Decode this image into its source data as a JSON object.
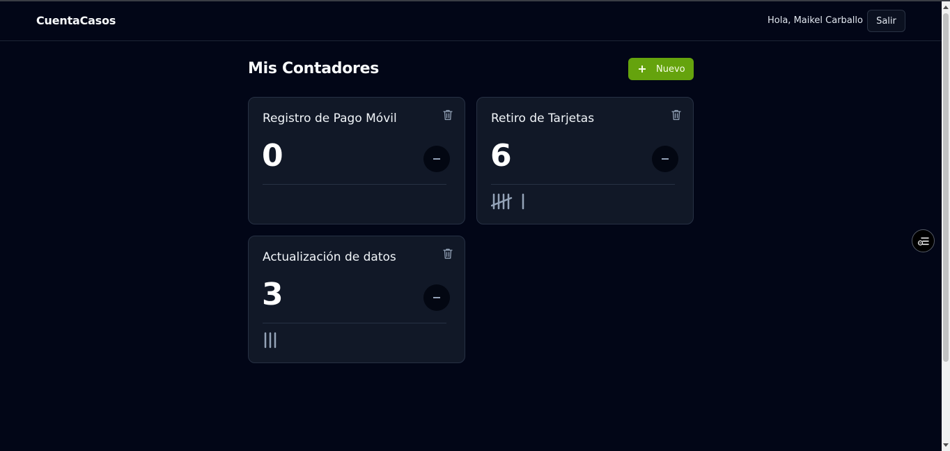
{
  "header": {
    "brand": "CuentaCasos",
    "greeting": "Hola, Maikel Carballo",
    "logout_label": "Salir"
  },
  "main": {
    "title": "Mis Contadores",
    "new_button_label": "Nuevo"
  },
  "counters": [
    {
      "name": "Registro de Pago Móvil",
      "count": "0",
      "tally_value": 0
    },
    {
      "name": "Retiro de Tarjetas",
      "count": "6",
      "tally_value": 6
    },
    {
      "name": "Actualización de datos",
      "count": "3",
      "tally_value": 3
    }
  ],
  "colors": {
    "background": "#020617",
    "card": "#111827",
    "accent": "#65a30d",
    "tally": "#94a3b8"
  },
  "icons": {
    "new": "plus-icon",
    "delete": "trash-icon",
    "decrement": "minus-icon",
    "side_widget": "accessibility-list-icon"
  }
}
